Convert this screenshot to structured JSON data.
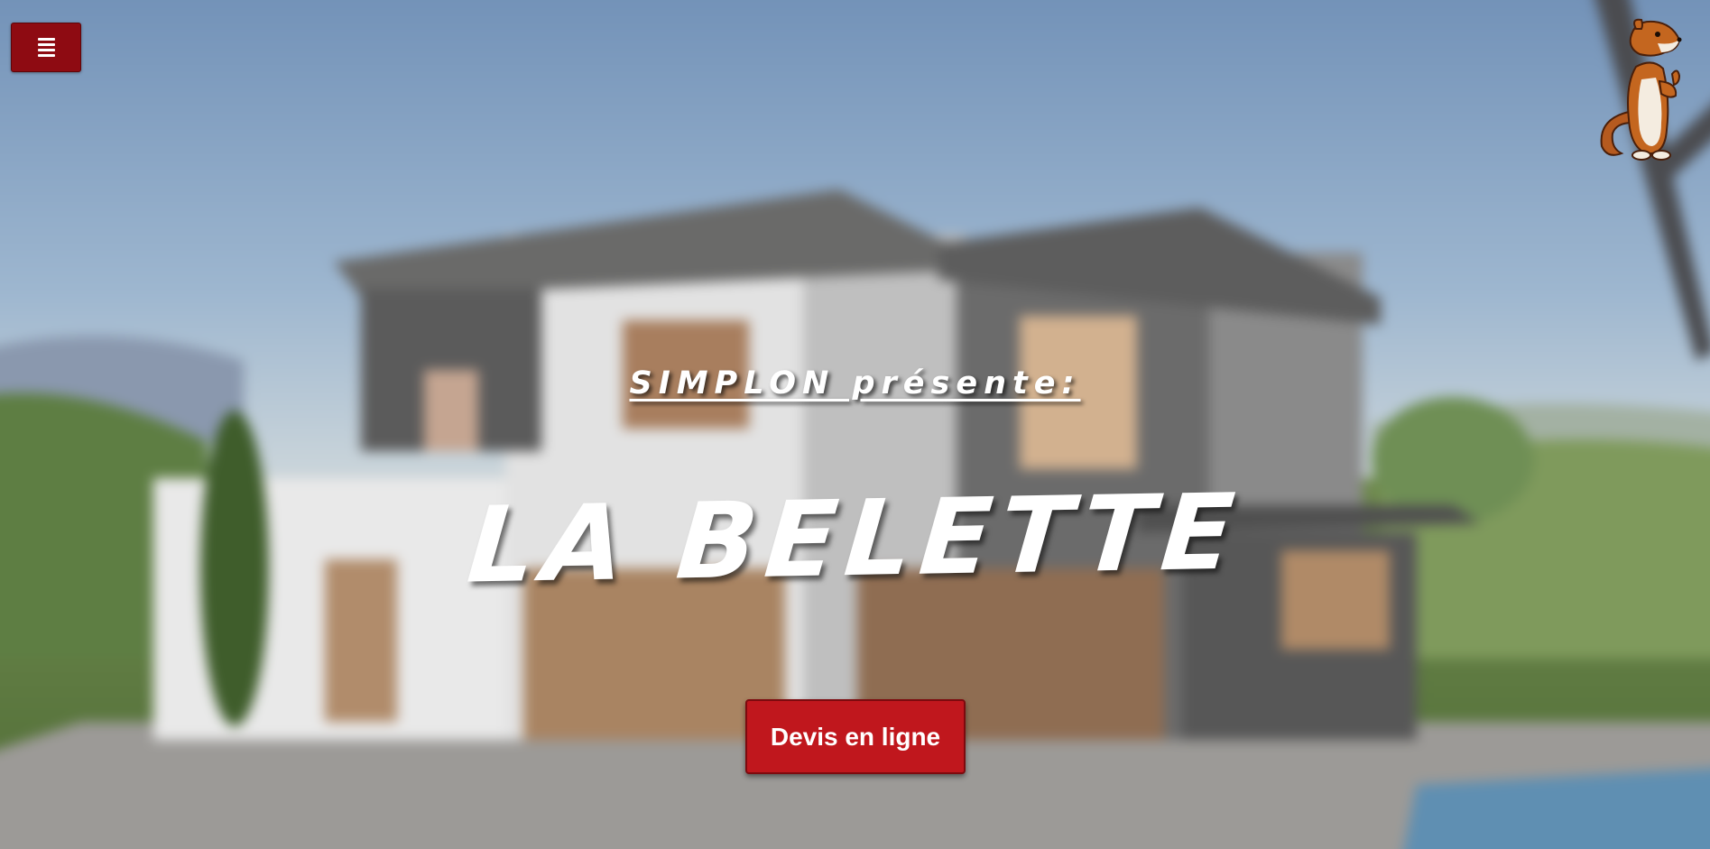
{
  "header": {
    "menu_icon": "hamburger-menu-icon",
    "mascot": "weasel-mascot-logo"
  },
  "hero": {
    "presents": "SIMPLON présente:",
    "title": "LA BELETTE",
    "cta_label": "Devis en ligne"
  },
  "colors": {
    "menu_button": "#8e0b12",
    "cta_button": "#c0171d",
    "text": "#ffffff"
  }
}
